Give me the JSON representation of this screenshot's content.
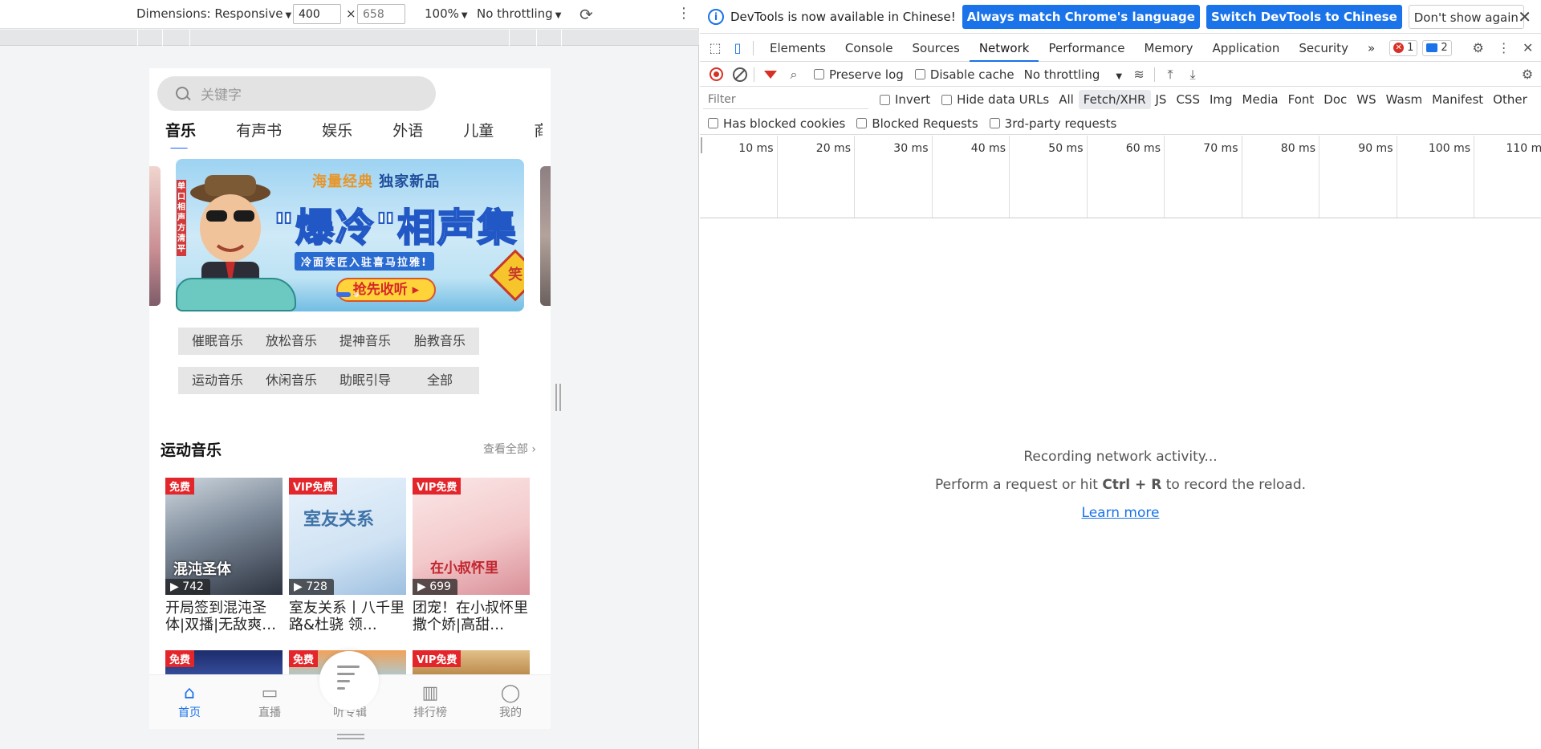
{
  "emulator": {
    "dimensions_label": "Dimensions: Responsive",
    "width_value": "400",
    "height_placeholder": "658",
    "times": "×",
    "zoom": "100%",
    "throttling": "No throttling"
  },
  "app": {
    "search_placeholder": "关键字",
    "tabs": [
      "音乐",
      "有声书",
      "娱乐",
      "外语",
      "儿童",
      "商业财"
    ],
    "banner": {
      "tagline_a": "海量经典",
      "tagline_b": "独家新品",
      "title": "\"爆冷\"相声集",
      "sub": "冷面笑匠入驻喜马拉雅!",
      "cta": "抢先收听 ▸",
      "vertical": "单口相声方清平",
      "sign": "笑"
    },
    "chips": [
      "催眠音乐",
      "放松音乐",
      "提神音乐",
      "胎教音乐",
      "运动音乐",
      "休闲音乐",
      "助眠引导",
      "全部"
    ],
    "section_title": "运动音乐",
    "view_all": "查看全部 ›",
    "cards": [
      {
        "badge": "免费",
        "plays": "▶ 742",
        "caption": "开局签到混沌圣体|双播|无敌爽…",
        "cover_text": "混沌圣体"
      },
      {
        "badge": "VIP免费",
        "plays": "▶ 728",
        "caption": "室友关系丨八千里路&杜骁 领…",
        "cover_text": "室友关系"
      },
      {
        "badge": "VIP免费",
        "plays": "▶ 699",
        "caption": "团宠！在小叔怀里撒个娇|高甜…",
        "cover_text": "在小叔怀里"
      }
    ],
    "cards_row2": [
      {
        "badge": "免费"
      },
      {
        "badge": "免费"
      },
      {
        "badge": "VIP免费"
      }
    ],
    "nav": [
      {
        "label": "首页",
        "glyph": "⌂"
      },
      {
        "label": "直播",
        "glyph": "▭"
      },
      {
        "label": "听专辑",
        "glyph": ""
      },
      {
        "label": "排行榜",
        "glyph": "▥"
      },
      {
        "label": "我的",
        "glyph": "◯"
      }
    ]
  },
  "devtools": {
    "infobar": {
      "message": "DevTools is now available in Chinese!",
      "btn_match": "Always match Chrome's language",
      "btn_switch": "Switch DevTools to Chinese",
      "btn_dismiss": "Don't show again"
    },
    "tabs": [
      "Elements",
      "Console",
      "Sources",
      "Network",
      "Performance",
      "Memory",
      "Application",
      "Security"
    ],
    "more": "»",
    "errors": "1",
    "messages": "2",
    "toolbar": {
      "preserve_log": "Preserve log",
      "disable_cache": "Disable cache",
      "throttling": "No throttling"
    },
    "filter": {
      "placeholder": "Filter",
      "invert": "Invert",
      "hide_data_urls": "Hide data URLs",
      "types": [
        "All",
        "Fetch/XHR",
        "JS",
        "CSS",
        "Img",
        "Media",
        "Font",
        "Doc",
        "WS",
        "Wasm",
        "Manifest",
        "Other"
      ]
    },
    "row3": {
      "blocked_cookies": "Has blocked cookies",
      "blocked_requests": "Blocked Requests",
      "third_party": "3rd-party requests"
    },
    "timeline_ticks": [
      "10 ms",
      "20 ms",
      "30 ms",
      "40 ms",
      "50 ms",
      "60 ms",
      "70 ms",
      "80 ms",
      "90 ms",
      "100 ms",
      "110 ms"
    ],
    "empty": {
      "line1": "Recording network activity...",
      "line2_pre": "Perform a request or hit ",
      "line2_key": "Ctrl + R",
      "line2_post": " to record the reload.",
      "learn_more": "Learn more"
    }
  },
  "colors": {
    "accent": "#1a73e8",
    "badge_red": "#e3262b",
    "record_red": "#d93025"
  }
}
